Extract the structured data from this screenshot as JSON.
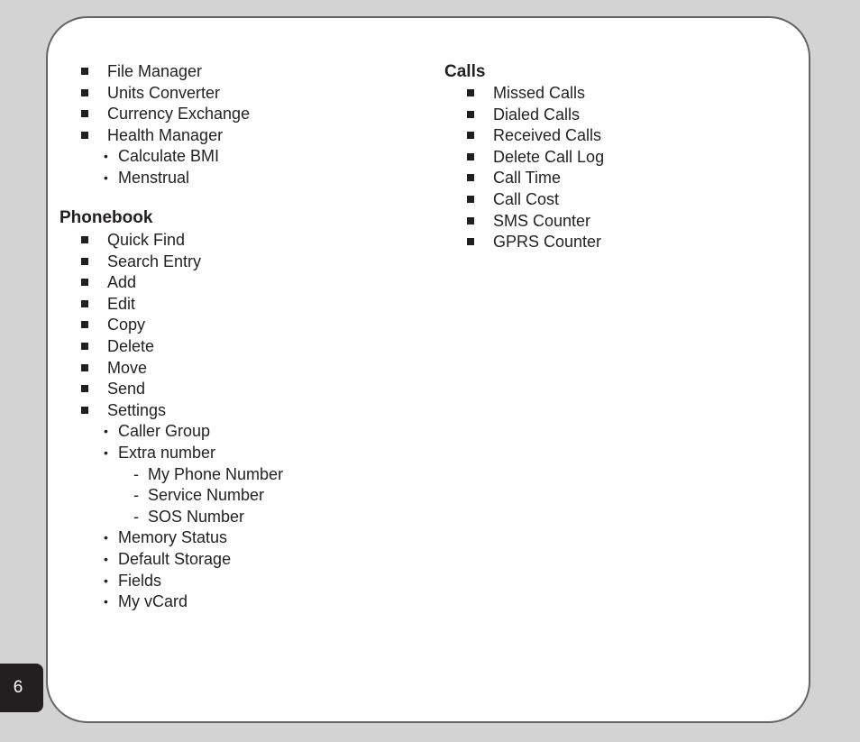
{
  "page_number": "6",
  "left_column": {
    "tools_items": [
      "File Manager",
      "Units Converter",
      "Currency Exchange",
      "Health Manager"
    ],
    "health_subitems": [
      "Calculate BMI",
      "Menstrual"
    ],
    "phonebook": {
      "heading": "Phonebook",
      "items": [
        "Quick Find",
        "Search Entry",
        "Add",
        "Edit",
        "Copy",
        "Delete",
        "Move",
        "Send",
        "Settings"
      ],
      "settings_subitems_a": [
        "Caller Group",
        "Extra number"
      ],
      "extra_number_subitems": [
        "My Phone Number",
        "Service Number",
        "SOS Number"
      ],
      "settings_subitems_b": [
        "Memory Status",
        "Default Storage",
        "Fields",
        "My vCard"
      ]
    }
  },
  "right_column": {
    "calls": {
      "heading": "Calls",
      "items": [
        "Missed Calls",
        "Dialed Calls",
        "Received Calls",
        "Delete Call Log",
        "Call Time",
        "Call Cost",
        "SMS Counter",
        "GPRS Counter"
      ]
    }
  },
  "markers": {
    "square": "square-bullet",
    "dot": "•",
    "dash": "-"
  }
}
